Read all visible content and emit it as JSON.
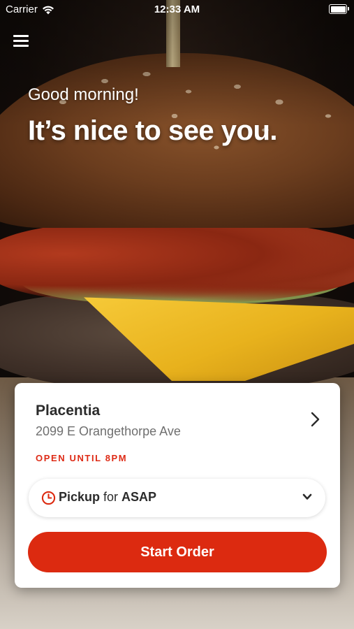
{
  "status_bar": {
    "carrier": "Carrier",
    "time": "12:33 AM"
  },
  "hero": {
    "greeting": "Good morning!",
    "headline": "It’s nice to see you."
  },
  "location": {
    "name": "Placentia",
    "address": "2099 E Orangethorpe Ave",
    "hours": "OPEN UNTIL 8PM"
  },
  "order_mode": {
    "mode": "Pickup",
    "connector": " for ",
    "time": "ASAP"
  },
  "cta": {
    "label": "Start Order"
  },
  "colors": {
    "accent": "#dc2a10",
    "hours_text": "#de2b16",
    "card": "#ffffff"
  },
  "icons": {
    "menu": "hamburger-menu-icon",
    "location_arrow": "chevron-right-icon",
    "clock": "clock-icon",
    "dropdown": "chevron-down-icon",
    "wifi": "wifi-icon",
    "battery": "battery-icon"
  }
}
